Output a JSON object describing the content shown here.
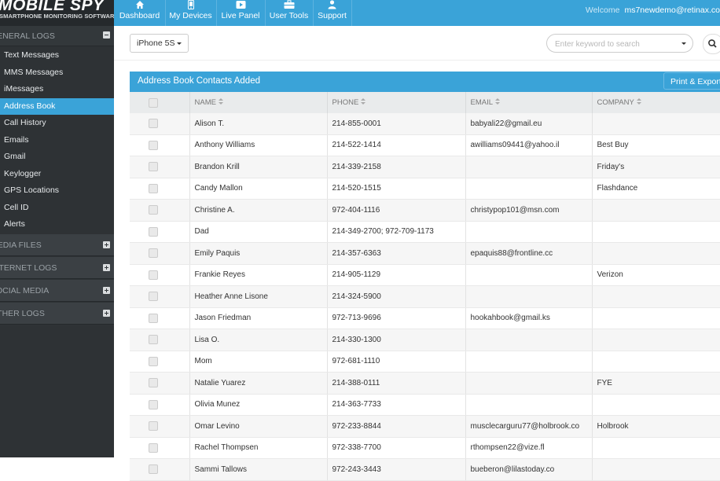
{
  "logo": {
    "brand": "MOBILE SPY",
    "tagline": "SMARTPHONE MONITORING SOFTWARE"
  },
  "sidebar": {
    "general_logs": {
      "title": "GENERAL LOGS",
      "items": [
        {
          "label": "Text Messages"
        },
        {
          "label": "MMS Messages"
        },
        {
          "label": "iMessages"
        },
        {
          "label": "Address Book"
        },
        {
          "label": "Call History"
        },
        {
          "label": "Emails"
        },
        {
          "label": "Gmail"
        },
        {
          "label": "Keylogger"
        },
        {
          "label": "GPS Locations"
        },
        {
          "label": "Cell ID"
        },
        {
          "label": "Alerts"
        }
      ]
    },
    "media_files": {
      "title": "MEDIA FILES"
    },
    "internet_logs": {
      "title": "INTERNET LOGS"
    },
    "social_media": {
      "title": "SOCIAL MEDIA"
    },
    "other_logs": {
      "title": "OTHER LOGS"
    }
  },
  "nav": {
    "items": [
      {
        "label": "Dashboard",
        "icon": "home-icon"
      },
      {
        "label": "My Devices",
        "icon": "phone-icon"
      },
      {
        "label": "Live Panel",
        "icon": "video-icon"
      },
      {
        "label": "User Tools",
        "icon": "toolbox-icon"
      },
      {
        "label": "Support",
        "icon": "user-icon"
      }
    ],
    "welcome_text": "Welcome",
    "user": "ms7newdemo@retinax.co"
  },
  "toolbar": {
    "device": "iPhone 5S",
    "search_placeholder": "Enter keyword to search"
  },
  "panel": {
    "title": "Address Book Contacts Added",
    "export_label": "Print & Export"
  },
  "table": {
    "columns": [
      "NAME",
      "PHONE",
      "EMAIL",
      "COMPANY"
    ],
    "rows": [
      {
        "name": "Alison T.",
        "phone": "214-855-0001",
        "email": "babyali22@gmail.eu",
        "company": ""
      },
      {
        "name": "Anthony Williams",
        "phone": "214-522-1414",
        "email": "awilliams09441@yahoo.il",
        "company": "Best Buy"
      },
      {
        "name": "Brandon Krill",
        "phone": "214-339-2158",
        "email": "",
        "company": "Friday's"
      },
      {
        "name": "Candy Mallon",
        "phone": "214-520-1515",
        "email": "",
        "company": "Flashdance"
      },
      {
        "name": "Christine A.",
        "phone": "972-404-1116",
        "email": "christypop101@msn.com",
        "company": ""
      },
      {
        "name": "Dad",
        "phone": "214-349-2700; 972-709-1173",
        "email": "",
        "company": ""
      },
      {
        "name": "Emily Paquis",
        "phone": "214-357-6363",
        "email": "epaquis88@frontline.cc",
        "company": ""
      },
      {
        "name": "Frankie Reyes",
        "phone": "214-905-1129",
        "email": "",
        "company": "Verizon"
      },
      {
        "name": "Heather Anne Lisone",
        "phone": "214-324-5900",
        "email": "",
        "company": ""
      },
      {
        "name": "Jason Friedman",
        "phone": "972-713-9696",
        "email": "hookahbook@gmail.ks",
        "company": ""
      },
      {
        "name": "Lisa O.",
        "phone": "214-330-1300",
        "email": "",
        "company": ""
      },
      {
        "name": "Mom",
        "phone": "972-681-1110",
        "email": "",
        "company": ""
      },
      {
        "name": "Natalie Yuarez",
        "phone": "214-388-0111",
        "email": "",
        "company": "FYE"
      },
      {
        "name": "Olivia Munez",
        "phone": "214-363-7733",
        "email": "",
        "company": ""
      },
      {
        "name": "Omar Levino",
        "phone": "972-233-8844",
        "email": "musclecarguru77@holbrook.co",
        "company": "Holbrook"
      },
      {
        "name": "Rachel Thompsen",
        "phone": "972-338-7700",
        "email": "rthompsen22@vize.fl",
        "company": ""
      },
      {
        "name": "Sammi Tallows",
        "phone": "972-243-3443",
        "email": "bueberon@lilastoday.co",
        "company": ""
      }
    ]
  },
  "colors": {
    "accent": "#3aa3d8",
    "sidebar": "#2e3235"
  }
}
